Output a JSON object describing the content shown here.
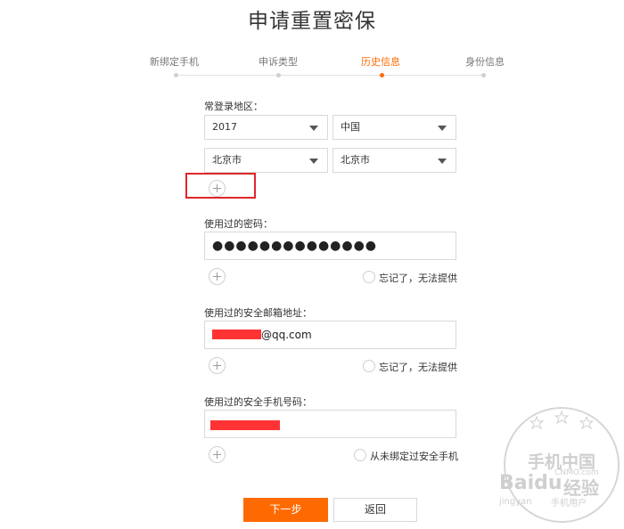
{
  "page": {
    "title": "申请重置密保"
  },
  "steps": [
    {
      "label": "新绑定手机",
      "active": false
    },
    {
      "label": "申诉类型",
      "active": false
    },
    {
      "label": "历史信息",
      "active": true
    },
    {
      "label": "身份信息",
      "active": false
    }
  ],
  "login_region": {
    "label": "常登录地区：",
    "year": "2017",
    "country": "中国",
    "province": "北京市",
    "city": "北京市"
  },
  "password": {
    "label": "使用过的密码：",
    "value": "●●●●●●●●●●●●●●",
    "forgot_label": "忘记了，无法提供"
  },
  "email": {
    "label": "使用过的安全邮箱地址：",
    "value_suffix": "@qq.com",
    "forgot_label": "忘记了，无法提供"
  },
  "phone": {
    "label": "使用过的安全手机号码：",
    "never_bound_label": "从未绑定过安全手机"
  },
  "buttons": {
    "next": "下一步",
    "back": "返回"
  },
  "watermark": {
    "line1": "手机中国",
    "line2": "CNMO.com",
    "brand": "Baidu",
    "brand_cn": "经验",
    "sub": "jingyan",
    "stamp": "手机用户"
  },
  "colors": {
    "accent": "#ff6a00",
    "highlight_border": "#e0262b",
    "redaction": "#ff3333"
  }
}
